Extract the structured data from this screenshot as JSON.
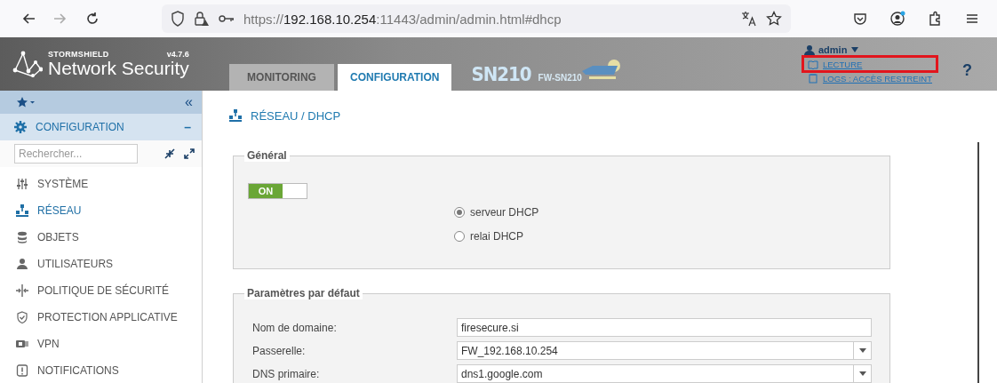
{
  "browser": {
    "url": {
      "scheme": "https://",
      "host": "192.168.10.254",
      "rest": ":11443/admin/admin.html#dhcp"
    }
  },
  "header": {
    "brand": "STORMSHIELD",
    "product": "Network Security",
    "version": "v4.7.6",
    "tabs": [
      {
        "label": "MONITORING",
        "selected": false
      },
      {
        "label": "CONFIGURATION",
        "selected": true
      }
    ],
    "model": "SN210",
    "device": "FW-SN210",
    "user": "admin",
    "links": [
      {
        "label": "LECTURE",
        "highlighted": true
      },
      {
        "label": "LOGS : ACCÈS RESTREINT",
        "highlighted": false
      }
    ],
    "help": "?"
  },
  "sidebar": {
    "collapse": "«",
    "section": "CONFIGURATION",
    "section_toggle": "–",
    "search": {
      "placeholder": "Rechercher..."
    },
    "items": [
      {
        "label": "SYSTÈME",
        "selected": false
      },
      {
        "label": "RÉSEAU",
        "selected": true
      },
      {
        "label": "OBJETS",
        "selected": false
      },
      {
        "label": "UTILISATEURS",
        "selected": false
      },
      {
        "label": "POLITIQUE DE SÉCURITÉ",
        "selected": false
      },
      {
        "label": "PROTECTION APPLICATIVE",
        "selected": false
      },
      {
        "label": "VPN",
        "selected": false
      },
      {
        "label": "NOTIFICATIONS",
        "selected": false
      }
    ]
  },
  "main": {
    "title": "RÉSEAU / DHCP",
    "general": {
      "legend": "Général",
      "toggle": {
        "label": "ON",
        "on": true
      },
      "options": [
        {
          "label": "serveur DHCP",
          "selected": true
        },
        {
          "label": "relai DHCP",
          "selected": false
        }
      ]
    },
    "defaults": {
      "legend": "Paramètres par défaut",
      "fields": [
        {
          "label": "Nom de domaine:",
          "value": "firesecure.si",
          "kind": "text"
        },
        {
          "label": "Passerelle:",
          "value": "FW_192.168.10.254",
          "kind": "select"
        },
        {
          "label": "DNS primaire:",
          "value": "dns1.google.com",
          "kind": "select"
        }
      ]
    }
  }
}
